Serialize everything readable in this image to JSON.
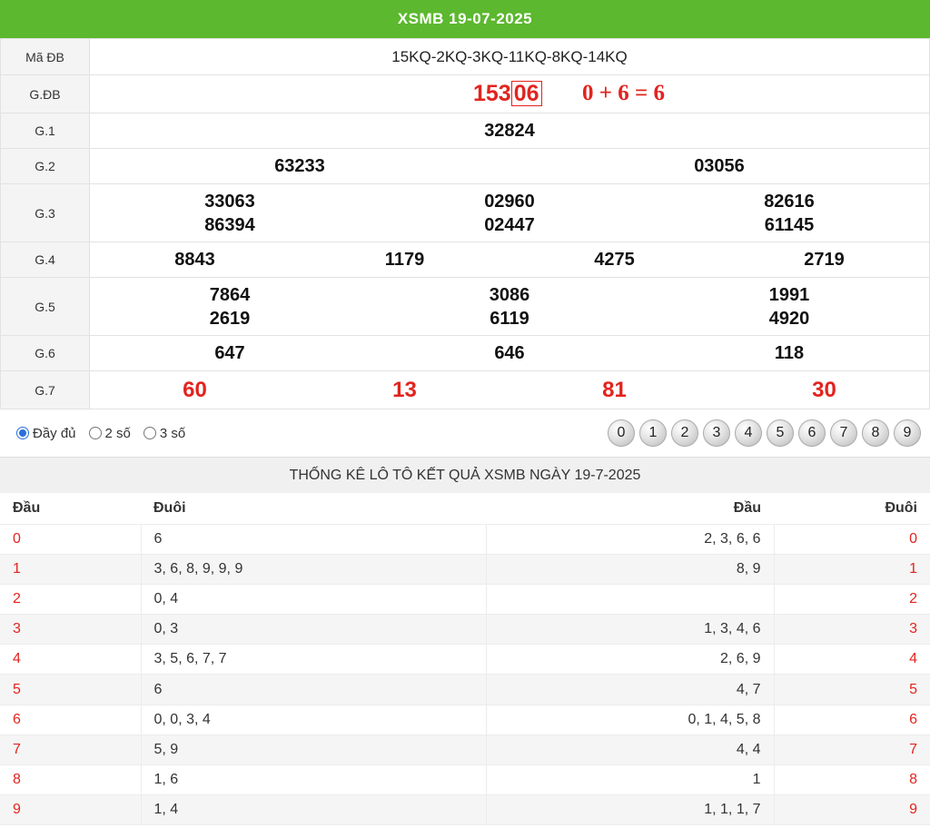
{
  "header": {
    "title": "XSMB 19-07-2025"
  },
  "results": {
    "ma_db": {
      "label": "Mã ĐB",
      "value": "15KQ-2KQ-3KQ-11KQ-8KQ-14KQ"
    },
    "gdb": {
      "label": "G.ĐB",
      "prefix": "153",
      "boxed": "06",
      "sum": "0 + 6 = 6"
    },
    "g1": {
      "label": "G.1",
      "values": [
        "32824"
      ]
    },
    "g2": {
      "label": "G.2",
      "values": [
        "63233",
        "03056"
      ]
    },
    "g3": {
      "label": "G.3",
      "values": [
        [
          "33063",
          "86394"
        ],
        [
          "02960",
          "02447"
        ],
        [
          "82616",
          "61145"
        ]
      ]
    },
    "g4": {
      "label": "G.4",
      "values": [
        "8843",
        "1179",
        "4275",
        "2719"
      ]
    },
    "g5": {
      "label": "G.5",
      "values": [
        [
          "7864",
          "2619"
        ],
        [
          "3086",
          "6119"
        ],
        [
          "1991",
          "4920"
        ]
      ]
    },
    "g6": {
      "label": "G.6",
      "values": [
        "647",
        "646",
        "118"
      ]
    },
    "g7": {
      "label": "G.7",
      "values": [
        "60",
        "13",
        "81",
        "30"
      ]
    }
  },
  "controls": {
    "options": [
      {
        "label": "Đầy đủ",
        "selected": true
      },
      {
        "label": "2 số",
        "selected": false
      },
      {
        "label": "3 số",
        "selected": false
      }
    ],
    "digits": [
      "0",
      "1",
      "2",
      "3",
      "4",
      "5",
      "6",
      "7",
      "8",
      "9"
    ]
  },
  "stats": {
    "title": "THỐNG KÊ LÔ TÔ KẾT QUẢ XSMB NGÀY 19-7-2025",
    "headers": [
      "Đầu",
      "Đuôi",
      "Đầu",
      "Đuôi"
    ],
    "rows": [
      {
        "dau": "0",
        "duoi_list": "6",
        "dau_list": "2, 3, 6, 6",
        "duoi": "0"
      },
      {
        "dau": "1",
        "duoi_list": "3, 6, 8, 9, 9, 9",
        "dau_list": "8, 9",
        "duoi": "1"
      },
      {
        "dau": "2",
        "duoi_list": "0, 4",
        "dau_list": "",
        "duoi": "2"
      },
      {
        "dau": "3",
        "duoi_list": "0, 3",
        "dau_list": "1, 3, 4, 6",
        "duoi": "3"
      },
      {
        "dau": "4",
        "duoi_list": "3, 5, 6, 7, 7",
        "dau_list": "2, 6, 9",
        "duoi": "4"
      },
      {
        "dau": "5",
        "duoi_list": "6",
        "dau_list": "4, 7",
        "duoi": "5"
      },
      {
        "dau": "6",
        "duoi_list": "0, 0, 3, 4",
        "dau_list": "0, 1, 4, 5, 8",
        "duoi": "6"
      },
      {
        "dau": "7",
        "duoi_list": "5, 9",
        "dau_list": "4, 4",
        "duoi": "7"
      },
      {
        "dau": "8",
        "duoi_list": "1, 6",
        "dau_list": "1",
        "duoi": "8"
      },
      {
        "dau": "9",
        "duoi_list": "1, 4",
        "dau_list": "1, 1, 1, 7",
        "duoi": "9"
      }
    ]
  },
  "colors": {
    "header_green": "#5cb82e",
    "accent_red": "#e2241f",
    "radio_blue": "#2a6fdb"
  }
}
